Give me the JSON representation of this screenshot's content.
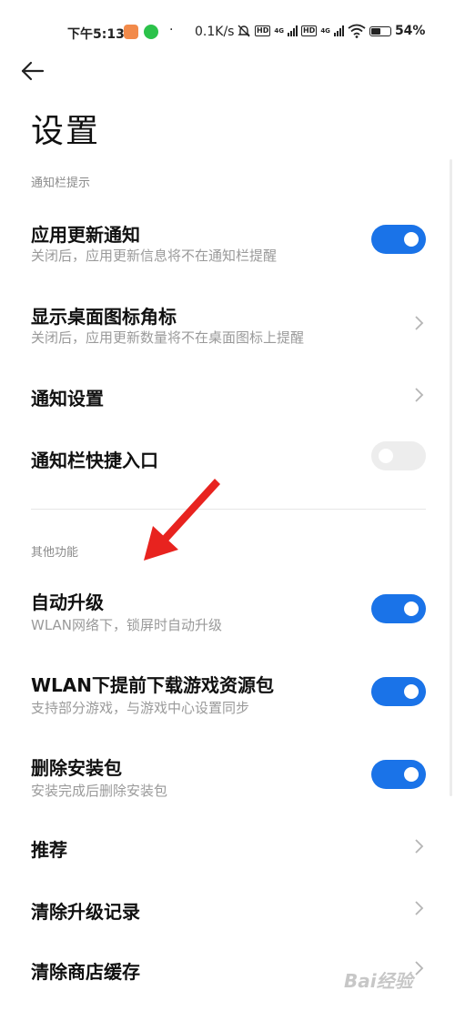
{
  "status_bar": {
    "time": "下午5:13",
    "dot": "·",
    "speed": "0.1K/s",
    "hd": "HD",
    "net": "4G",
    "battery": "54%",
    "battery_level": 54
  },
  "page": {
    "title": "设置"
  },
  "sections": [
    {
      "header": "通知栏提示"
    },
    {
      "header": "其他功能"
    }
  ],
  "rows": [
    {
      "title": "应用更新通知",
      "subtitle": "关闭后，应用更新信息将不在通知栏提醒",
      "control": "toggle",
      "on": true
    },
    {
      "title": "显示桌面图标角标",
      "subtitle": "关闭后，应用更新数量将不在桌面图标上提醒",
      "control": "chevron"
    },
    {
      "title": "通知设置",
      "control": "chevron"
    },
    {
      "title": "通知栏快捷入口",
      "control": "toggle",
      "on": false
    },
    {
      "title": "自动升级",
      "subtitle": "WLAN网络下，锁屏时自动升级",
      "control": "toggle",
      "on": true
    },
    {
      "title": "WLAN下提前下载游戏资源包",
      "subtitle": "支持部分游戏，与游戏中心设置同步",
      "control": "toggle",
      "on": true
    },
    {
      "title": "删除安装包",
      "subtitle": "安装完成后删除安装包",
      "control": "toggle",
      "on": true
    },
    {
      "title": "推荐",
      "control": "chevron"
    },
    {
      "title": "清除升级记录",
      "control": "chevron"
    },
    {
      "title": "清除商店缓存",
      "control": "chevron"
    }
  ],
  "watermark": "Bai经验",
  "colors": {
    "accent": "#1a73e8",
    "annotation_arrow": "#e8231f"
  }
}
